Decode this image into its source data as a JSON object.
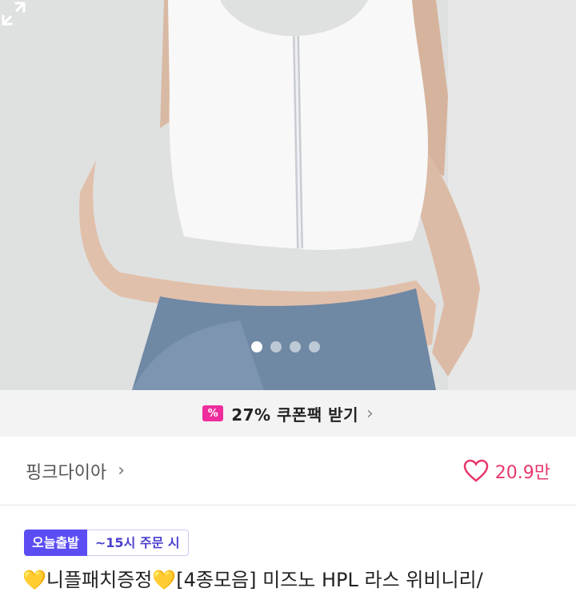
{
  "gallery": {
    "total_images": 4,
    "active_index": 1,
    "expand_icon": "fullscreen-expand-icon"
  },
  "coupon": {
    "icon": "coupon-percent-icon",
    "label": "27% 쿠폰팩 받기",
    "icon_color": "#ee2c9c"
  },
  "store": {
    "name": "핑크다이아",
    "chevron": "›",
    "likes": "20.9만",
    "heart_color": "#e8376b"
  },
  "shipping": {
    "today_badge": "오늘출발",
    "deadline": "~15시 주문 시",
    "badge_color": "#5b4df2"
  },
  "product": {
    "title": "💛니플패치증정💛[4종모음] 미즈노 HPL 라스 위비니리/"
  }
}
